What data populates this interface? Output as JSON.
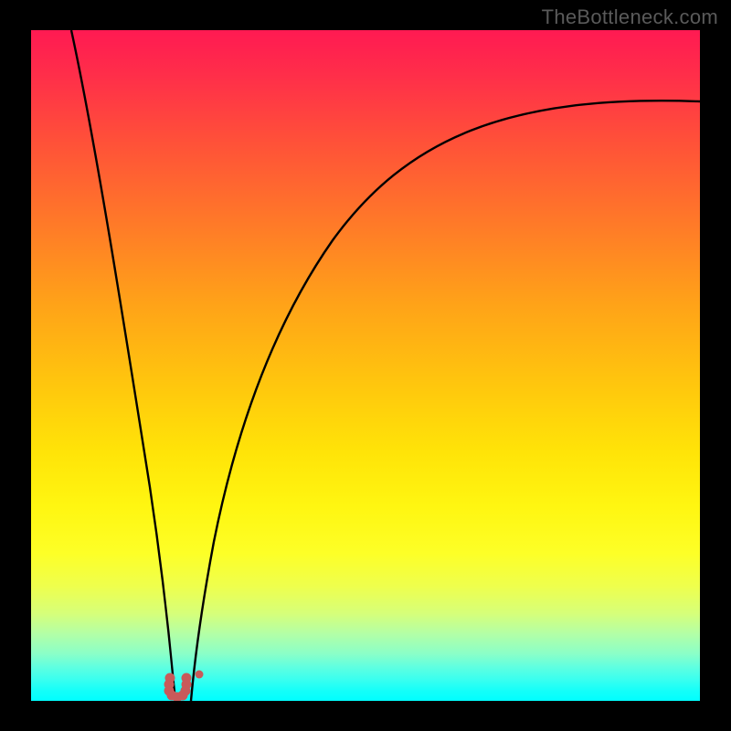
{
  "attribution": "TheBottleneck.com",
  "colors": {
    "frame": "#000000",
    "curve": "#000000",
    "marker": "#c85a5a",
    "gradient_top": "#ff1a52",
    "gradient_bottom": "#00ffff"
  },
  "chart_data": {
    "type": "line",
    "title": "",
    "xlabel": "",
    "ylabel": "",
    "xlim": [
      0,
      100
    ],
    "ylim": [
      0,
      100
    ],
    "legend": false,
    "grid": false,
    "series": [
      {
        "name": "left-branch",
        "x": [
          6,
          8,
          10,
          12,
          14,
          16,
          18,
          19,
          20,
          20.5,
          21
        ],
        "y": [
          100,
          86,
          72,
          59,
          47,
          35,
          22,
          14,
          7,
          3,
          0
        ]
      },
      {
        "name": "right-branch",
        "x": [
          24,
          25,
          26,
          28,
          30,
          34,
          40,
          48,
          58,
          70,
          84,
          100
        ],
        "y": [
          0,
          5,
          11,
          21,
          30,
          43,
          57,
          68,
          77,
          83,
          87,
          89
        ]
      }
    ],
    "markers": {
      "shape": "u-curve",
      "color": "#c85a5a",
      "points": [
        {
          "x": 20.8,
          "y": 3.4
        },
        {
          "x": 20.6,
          "y": 2.4
        },
        {
          "x": 20.6,
          "y": 1.4
        },
        {
          "x": 21.0,
          "y": 0.8
        },
        {
          "x": 21.8,
          "y": 0.6
        },
        {
          "x": 22.6,
          "y": 0.8
        },
        {
          "x": 23.0,
          "y": 1.4
        },
        {
          "x": 23.2,
          "y": 2.4
        },
        {
          "x": 23.2,
          "y": 3.4
        },
        {
          "x": 25.1,
          "y": 4.0
        }
      ]
    }
  }
}
